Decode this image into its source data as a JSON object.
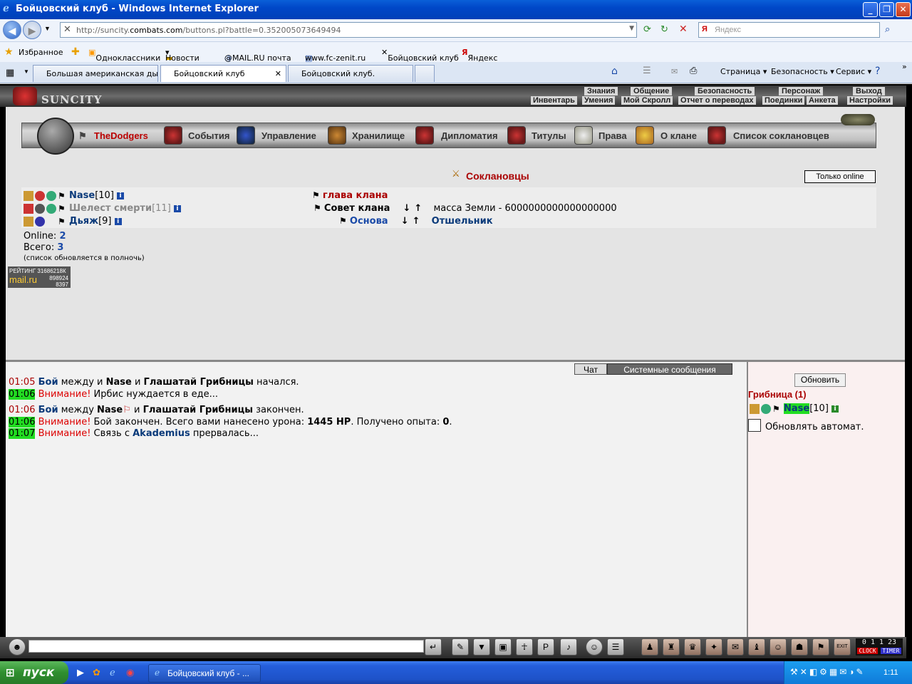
{
  "window": {
    "title": "Бойцовский клуб - Windows Internet Explorer",
    "controls": [
      "minimize",
      "maximize",
      "close"
    ]
  },
  "address_bar": {
    "url_prefix": "http://suncity.",
    "url_domain": "combats.com",
    "url_suffix": "/buttons.pl?battle=0.352005073649494",
    "search_placeholder": "Яндекс"
  },
  "favorites": {
    "label": "Избранное",
    "items": [
      "Одноклассники",
      "Новости",
      "@MAIL.RU почта",
      "www.fc-zenit.ru",
      "Бойцовский клуб",
      "Яндекс"
    ]
  },
  "tabs": [
    {
      "label": "Большая американская ды...",
      "active": false
    },
    {
      "label": "Бойцовский клуб",
      "active": true
    },
    {
      "label": "Бойцовский клуб.",
      "active": false
    }
  ],
  "command_bar": {
    "page": "Страница",
    "safety": "Безопасность",
    "service": "Сервис"
  },
  "game": {
    "logo": "SUNCITY",
    "top_menu_row1": [
      "Знания",
      "Общение",
      "Безопасность",
      "Персонаж",
      "Выход"
    ],
    "top_menu_row2": [
      "Инвентарь",
      "Умения",
      "Мой Скролл",
      "Отчет о переводах",
      "Поединки",
      "Анкета",
      "Настройки"
    ],
    "clan_name": "TheDodgers",
    "clan_menu": [
      "События",
      "Управление",
      "Хранилище",
      "Дипломатия",
      "Титулы",
      "Права",
      "О клане",
      "Список соклановцев"
    ],
    "members_title": "Соклановцы",
    "only_online_button": "Только online",
    "members": [
      {
        "name": "Nase",
        "level": "[10]",
        "rank": "глава клана",
        "rank_color": "#aa0000",
        "extra": ""
      },
      {
        "name": "Шелест смерти",
        "level": "[11]",
        "rank": "Совет клана",
        "rank_color": "#000000",
        "extra": "масса Земли - 6000000000000000000"
      },
      {
        "name": "Дьяж",
        "level": "[9]",
        "rank": "Основа",
        "rank_color": "#1a4aa8",
        "extra": "Отшельник"
      }
    ],
    "online_label": "Online:",
    "online_count": "2",
    "total_label": "Всего:",
    "total_count": "3",
    "list_note": "(список обновляется в полночь)",
    "rating_widget": {
      "label": "РЕЙТИНГ",
      "value": "31686218К",
      "brand": "mail.ru",
      "n1": "898924",
      "n2": "8397"
    }
  },
  "chat": {
    "tab_chat": "Чат",
    "tab_system": "Системные сообщения",
    "lines": [
      {
        "time": "01:05",
        "style": "t1",
        "parts": [
          "Бой",
          " между  и ",
          "Nase",
          " и ",
          "Глашатай Грибницы",
          " начался."
        ]
      },
      {
        "time": "01:06",
        "style": "t2",
        "warn": "Внимание!",
        "text": " Ирбис нуждается в еде..."
      },
      {
        "time": "01:06",
        "style": "t1",
        "parts": [
          "Бой",
          " между ",
          "Nase",
          " и ",
          "Глашатай Грибницы",
          " закончен."
        ]
      },
      {
        "time": "01:06",
        "style": "t2",
        "warn": "Внимание!",
        "text": " Бой закончен. Всего вами нанесено урона: ",
        "b1": "1445 HP",
        "text2": ". Получено опыта: ",
        "b2": "0",
        "text3": "."
      },
      {
        "time": "01:07",
        "style": "t2",
        "warn": "Внимание!",
        "text": " Связь с ",
        "b1": "Akademius",
        "text2": " прервалась..."
      }
    ]
  },
  "room": {
    "refresh_button": "Обновить",
    "title": "Грибница (1)",
    "user": "Nase",
    "user_level": "[10]",
    "auto_label": "Обновлять автомат."
  },
  "clock": {
    "time": "0 1 1 23",
    "label1": "CLOCK",
    "label2": "TIMER"
  },
  "taskbar": {
    "start": "пуск",
    "item": "Бойцовский клуб - ...",
    "time": "1:11"
  }
}
